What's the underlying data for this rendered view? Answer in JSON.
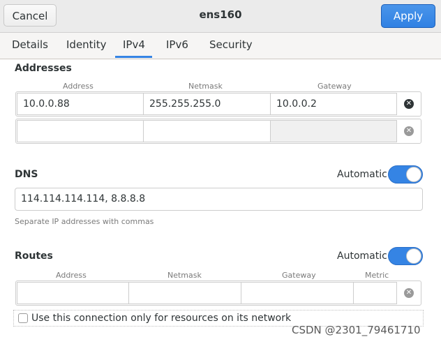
{
  "header": {
    "cancel_label": "Cancel",
    "title": "ens160",
    "apply_label": "Apply"
  },
  "tabs": [
    {
      "label": "Details"
    },
    {
      "label": "Identity"
    },
    {
      "label": "IPv4",
      "active": true
    },
    {
      "label": "IPv6"
    },
    {
      "label": "Security"
    }
  ],
  "addresses": {
    "title": "Addresses",
    "columns": [
      "Address",
      "Netmask",
      "Gateway"
    ],
    "rows": [
      {
        "address": "10.0.0.88",
        "netmask": "255.255.255.0",
        "gateway": "10.0.0.2"
      },
      {
        "address": "",
        "netmask": "",
        "gateway": ""
      }
    ]
  },
  "dns": {
    "title": "DNS",
    "automatic_label": "Automatic",
    "automatic_on": true,
    "value": "114.114.114.114, 8.8.8.8",
    "hint": "Separate IP addresses with commas"
  },
  "routes": {
    "title": "Routes",
    "automatic_label": "Automatic",
    "automatic_on": true,
    "columns": [
      "Address",
      "Netmask",
      "Gateway",
      "Metric"
    ]
  },
  "only_resources_label": "Use this connection only for resources on its network",
  "watermark": "CSDN @2301_79461710",
  "colors": {
    "accent": "#3584e4",
    "apply_bg": "#3081e3"
  }
}
